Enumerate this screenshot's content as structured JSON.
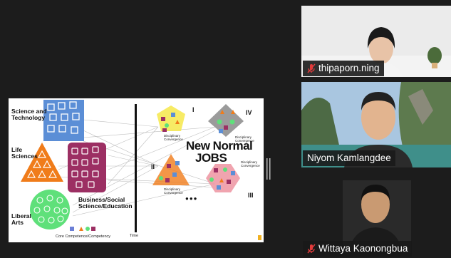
{
  "slide": {
    "labels": {
      "science": "Science and\nTechnology",
      "life": "Life\nSciences",
      "liberal": "Liberal\nArts",
      "business": "Business/Social\nScience/Education",
      "core": "Core Competence/Competency",
      "time": "Time",
      "new_normal": "New Normal",
      "jobs": "JOBS",
      "disc": "Disciplinary\nConvergence",
      "ellipsis": "●●●"
    },
    "romans": [
      "I",
      "II",
      "III",
      "IV"
    ]
  },
  "participants": [
    {
      "name": "thipaporn.ning",
      "muted": true
    },
    {
      "name": "Niyom Kamlangdee",
      "muted": false
    },
    {
      "name": "Wittaya Kaonongbua",
      "muted": true
    }
  ],
  "colors": {
    "muted_icon": "#e23b3b",
    "background": "#1c1c1c"
  }
}
